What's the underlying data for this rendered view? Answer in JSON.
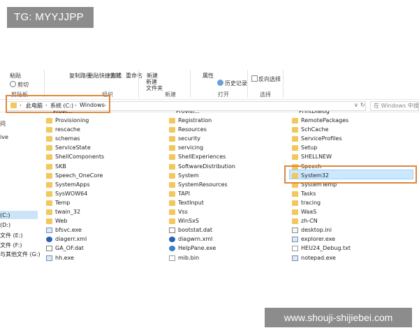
{
  "watermarks": {
    "top": "TG: MYYJJPP",
    "bottom": "www.shouji-shijiebei.com"
  },
  "ribbon": {
    "cut_labels": [
      "粘贴",
      "复制路径",
      "粘贴快捷方式",
      "删除",
      "重命名",
      "新建",
      "属性"
    ],
    "cut_button": "剪切",
    "new_folder": [
      "新建",
      "文件夹"
    ],
    "history": "历史记录",
    "invert_select": "反向选择",
    "groups": [
      "剪贴板",
      "组织",
      "新建",
      "打开",
      "选择"
    ]
  },
  "address_bar": {
    "crumbs": [
      "此电脑",
      "系统 (C:)",
      "Windows"
    ],
    "search_placeholder": "在 Windows 中搜索",
    "controls": {
      "dropdown": "∨",
      "refresh": "↻"
    }
  },
  "nav_pane": {
    "items": [
      "问",
      "ive",
      "(C:)",
      "(D:)",
      "文件 (E:)",
      "文件 (F:)",
      "与其他文件 (G:)"
    ],
    "selected": "(C:)"
  },
  "files": {
    "col1": [
      {
        "name": "Provisioning",
        "type": "folder"
      },
      {
        "name": "rescache",
        "type": "folder"
      },
      {
        "name": "schemas",
        "type": "folder"
      },
      {
        "name": "ServiceState",
        "type": "folder"
      },
      {
        "name": "ShellComponents",
        "type": "folder"
      },
      {
        "name": "SKB",
        "type": "folder"
      },
      {
        "name": "Speech_OneCore",
        "type": "folder"
      },
      {
        "name": "SystemApps",
        "type": "folder"
      },
      {
        "name": "SysWOW64",
        "type": "folder"
      },
      {
        "name": "Temp",
        "type": "folder"
      },
      {
        "name": "twain_32",
        "type": "folder"
      },
      {
        "name": "Web",
        "type": "folder"
      },
      {
        "name": "bfsvc.exe",
        "type": "exe"
      },
      {
        "name": "diagerr.xml",
        "type": "xml"
      },
      {
        "name": "GA_OF.dat",
        "type": "dat"
      },
      {
        "name": "hh.exe",
        "type": "exe"
      }
    ],
    "col2": [
      {
        "name": "Registration",
        "type": "folder"
      },
      {
        "name": "Resources",
        "type": "folder"
      },
      {
        "name": "security",
        "type": "folder"
      },
      {
        "name": "servicing",
        "type": "folder"
      },
      {
        "name": "ShellExperiences",
        "type": "folder"
      },
      {
        "name": "SoftwareDistribution",
        "type": "folder"
      },
      {
        "name": "System",
        "type": "folder"
      },
      {
        "name": "SystemResources",
        "type": "folder"
      },
      {
        "name": "TAPI",
        "type": "folder"
      },
      {
        "name": "TextInput",
        "type": "folder"
      },
      {
        "name": "Vss",
        "type": "folder"
      },
      {
        "name": "WinSxS",
        "type": "folder"
      },
      {
        "name": "bootstat.dat",
        "type": "dat"
      },
      {
        "name": "diagwrn.xml",
        "type": "xml"
      },
      {
        "name": "HelpPane.exe",
        "type": "help"
      },
      {
        "name": "mib.bin",
        "type": "doc"
      }
    ],
    "col3": [
      {
        "name": "RemotePackages",
        "type": "folder"
      },
      {
        "name": "SchCache",
        "type": "folder"
      },
      {
        "name": "ServiceProfiles",
        "type": "folder"
      },
      {
        "name": "Setup",
        "type": "folder"
      },
      {
        "name": "SHELLNEW",
        "type": "folder"
      },
      {
        "name": "Speech",
        "type": "folder"
      },
      {
        "name": "System32",
        "type": "folder"
      },
      {
        "name": "SystemTemp",
        "type": "folder"
      },
      {
        "name": "Tasks",
        "type": "folder"
      },
      {
        "name": "tracing",
        "type": "folder"
      },
      {
        "name": "WaaS",
        "type": "folder"
      },
      {
        "name": "zh-CN",
        "type": "folder"
      },
      {
        "name": "desktop.ini",
        "type": "ini"
      },
      {
        "name": "explorer.exe",
        "type": "exe"
      },
      {
        "name": "HEU24_Debug.txt",
        "type": "txt"
      },
      {
        "name": "notepad.exe",
        "type": "exe"
      }
    ],
    "top_cut": [
      "Provi...",
      "Provisi...",
      "PrintDialog"
    ],
    "selected": "System32"
  }
}
